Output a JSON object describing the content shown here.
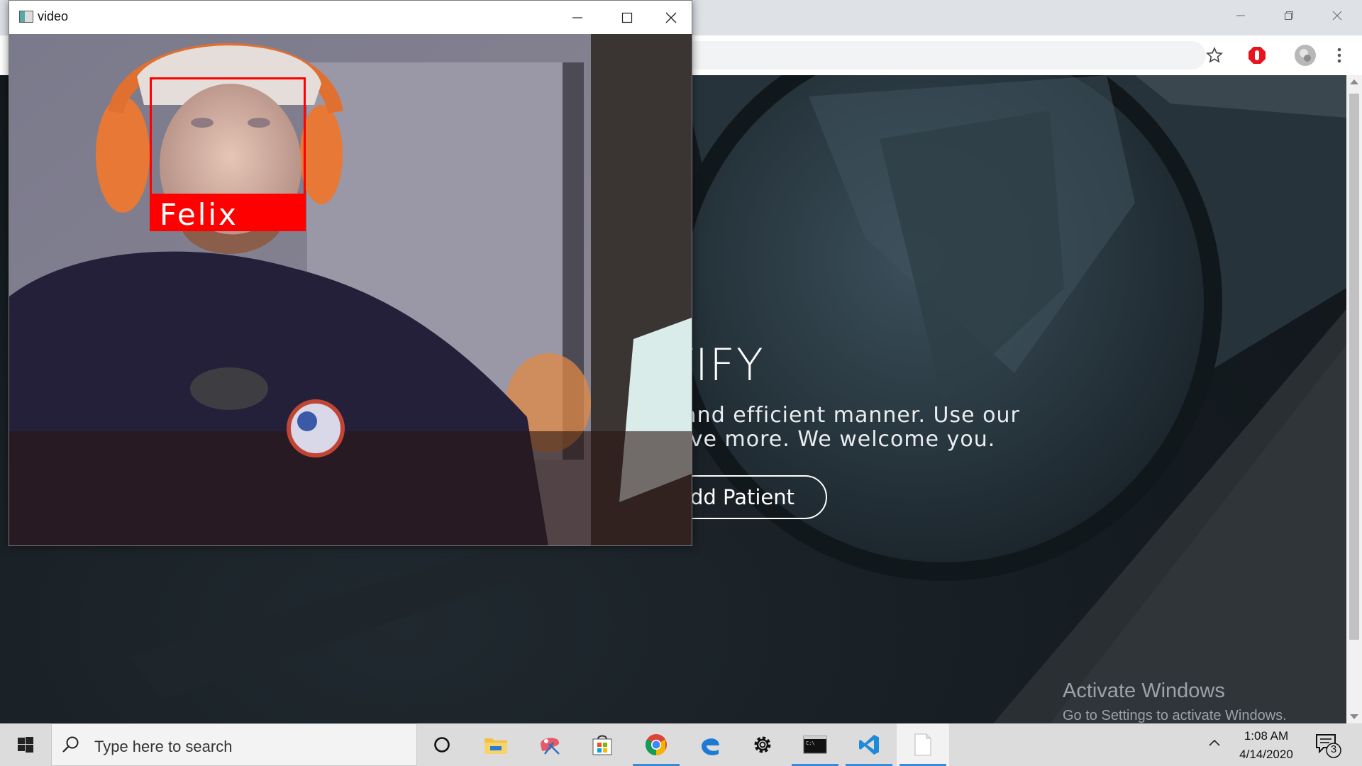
{
  "video_window": {
    "title": "video",
    "detection_label": "Felix"
  },
  "browser": {
    "controls": {
      "minimize": "minimize",
      "restore": "restore",
      "close": "close"
    }
  },
  "hero": {
    "title": "TIFY",
    "line1": "t and efficient manner. Use our",
    "line2": "erve more. We welcome you.",
    "button": "Add Patient"
  },
  "watermark": {
    "title": "Activate Windows",
    "subtitle": "Go to Settings to activate Windows."
  },
  "taskbar": {
    "search_placeholder": "Type here to search",
    "time": "1:08 AM",
    "date": "4/14/2020",
    "notification_count": "3",
    "apps": [
      "cortana-icon",
      "file-explorer-icon",
      "snip-sketch-icon",
      "store-icon",
      "chrome-icon",
      "edge-icon",
      "settings-icon",
      "terminal-icon",
      "vscode-icon",
      "notepad-icon"
    ]
  },
  "colors": {
    "detection_red": "#ff0000",
    "taskbar_bg": "#dcdcdc",
    "accent_blue": "#3b8ad6"
  }
}
